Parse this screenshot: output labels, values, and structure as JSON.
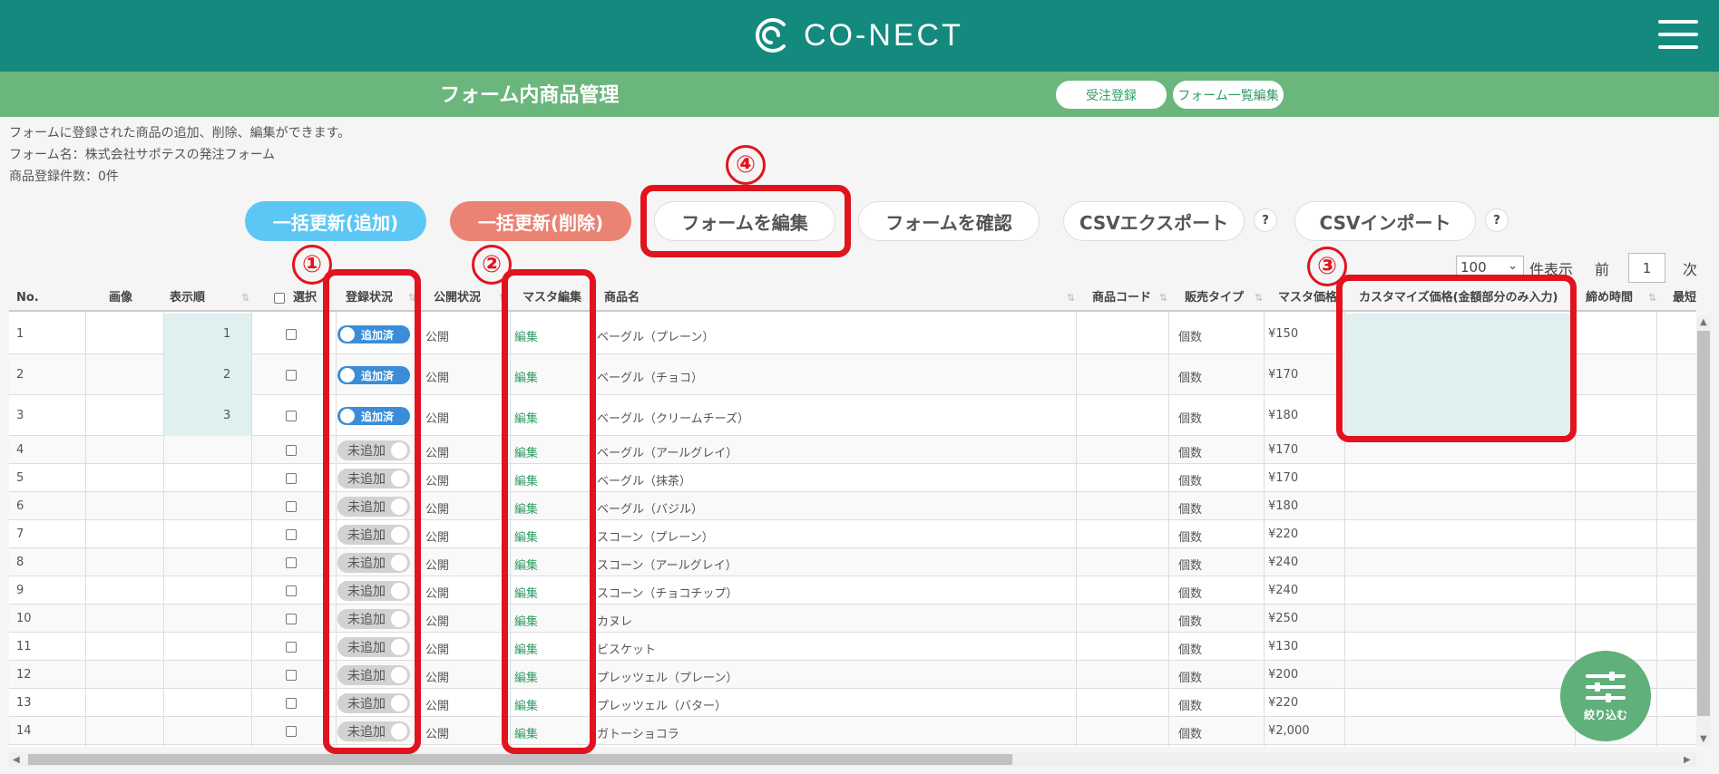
{
  "header": {
    "logo_text": "CO-NECT"
  },
  "subheader": {
    "title": "フォーム内商品管理",
    "order_button": "受注登録",
    "form_list_button": "フォーム一覧編集"
  },
  "info": {
    "description": "フォームに登録された商品の追加、削除、編集ができます。",
    "form_name": "フォーム名：株式会社サポテスの発注フォーム",
    "count": "商品登録件数：0件"
  },
  "actions": {
    "bulk_add": "一括更新(追加)",
    "bulk_delete": "一括更新(削除)",
    "edit_form": "フォームを編集",
    "confirm_form": "フォームを確認",
    "csv_export": "CSVエクスポート",
    "csv_import": "CSVインポート",
    "help": "?"
  },
  "pager": {
    "per_page": "100",
    "per_page_label": "件表示",
    "prev": "前",
    "page": "1",
    "next": "次"
  },
  "table": {
    "headers": {
      "no": "No.",
      "image": "画像",
      "order": "表示順",
      "select": "選択",
      "status": "登録状況",
      "publish": "公開状況",
      "master_edit": "マスタ編集",
      "name": "商品名",
      "code": "商品コード",
      "sale_type": "販売タイプ",
      "master_price": "マスタ価格",
      "custom_price": "カスタマイズ価格(金額部分のみ入力)",
      "deadline": "締め時間",
      "shortest": "最短納品"
    },
    "rows": [
      {
        "no": "1",
        "order": "1",
        "status": "追加済",
        "publish": "公開",
        "edit": "編集",
        "name": "ベーグル（プレーン）",
        "sale_type": "個数",
        "price": "¥150"
      },
      {
        "no": "2",
        "order": "2",
        "status": "追加済",
        "publish": "公開",
        "edit": "編集",
        "name": "ベーグル（チョコ）",
        "sale_type": "個数",
        "price": "¥170"
      },
      {
        "no": "3",
        "order": "3",
        "status": "追加済",
        "publish": "公開",
        "edit": "編集",
        "name": "ベーグル（クリームチーズ）",
        "sale_type": "個数",
        "price": "¥180"
      },
      {
        "no": "4",
        "order": "",
        "status": "未追加",
        "publish": "公開",
        "edit": "編集",
        "name": "ベーグル（アールグレイ）",
        "sale_type": "個数",
        "price": "¥170"
      },
      {
        "no": "5",
        "order": "",
        "status": "未追加",
        "publish": "公開",
        "edit": "編集",
        "name": "ベーグル（抹茶）",
        "sale_type": "個数",
        "price": "¥170"
      },
      {
        "no": "6",
        "order": "",
        "status": "未追加",
        "publish": "公開",
        "edit": "編集",
        "name": "ベーグル（バジル）",
        "sale_type": "個数",
        "price": "¥180"
      },
      {
        "no": "7",
        "order": "",
        "status": "未追加",
        "publish": "公開",
        "edit": "編集",
        "name": "スコーン（プレーン）",
        "sale_type": "個数",
        "price": "¥220"
      },
      {
        "no": "8",
        "order": "",
        "status": "未追加",
        "publish": "公開",
        "edit": "編集",
        "name": "スコーン（アールグレイ）",
        "sale_type": "個数",
        "price": "¥240"
      },
      {
        "no": "9",
        "order": "",
        "status": "未追加",
        "publish": "公開",
        "edit": "編集",
        "name": "スコーン（チョコチップ）",
        "sale_type": "個数",
        "price": "¥240"
      },
      {
        "no": "10",
        "order": "",
        "status": "未追加",
        "publish": "公開",
        "edit": "編集",
        "name": "カヌレ",
        "sale_type": "個数",
        "price": "¥250"
      },
      {
        "no": "11",
        "order": "",
        "status": "未追加",
        "publish": "公開",
        "edit": "編集",
        "name": "ビスケット",
        "sale_type": "個数",
        "price": "¥130"
      },
      {
        "no": "12",
        "order": "",
        "status": "未追加",
        "publish": "公開",
        "edit": "編集",
        "name": "プレッツェル（プレーン）",
        "sale_type": "個数",
        "price": "¥200"
      },
      {
        "no": "13",
        "order": "",
        "status": "未追加",
        "publish": "公開",
        "edit": "編集",
        "name": "プレッツェル（バター）",
        "sale_type": "個数",
        "price": "¥220"
      },
      {
        "no": "14",
        "order": "",
        "status": "未追加",
        "publish": "公開",
        "edit": "編集",
        "name": "ガトーショコラ",
        "sale_type": "個数",
        "price": "¥2,000"
      }
    ]
  },
  "fab": {
    "label": "絞り込む"
  },
  "annotations": {
    "n1": "①",
    "n2": "②",
    "n3": "③",
    "n4": "④"
  }
}
